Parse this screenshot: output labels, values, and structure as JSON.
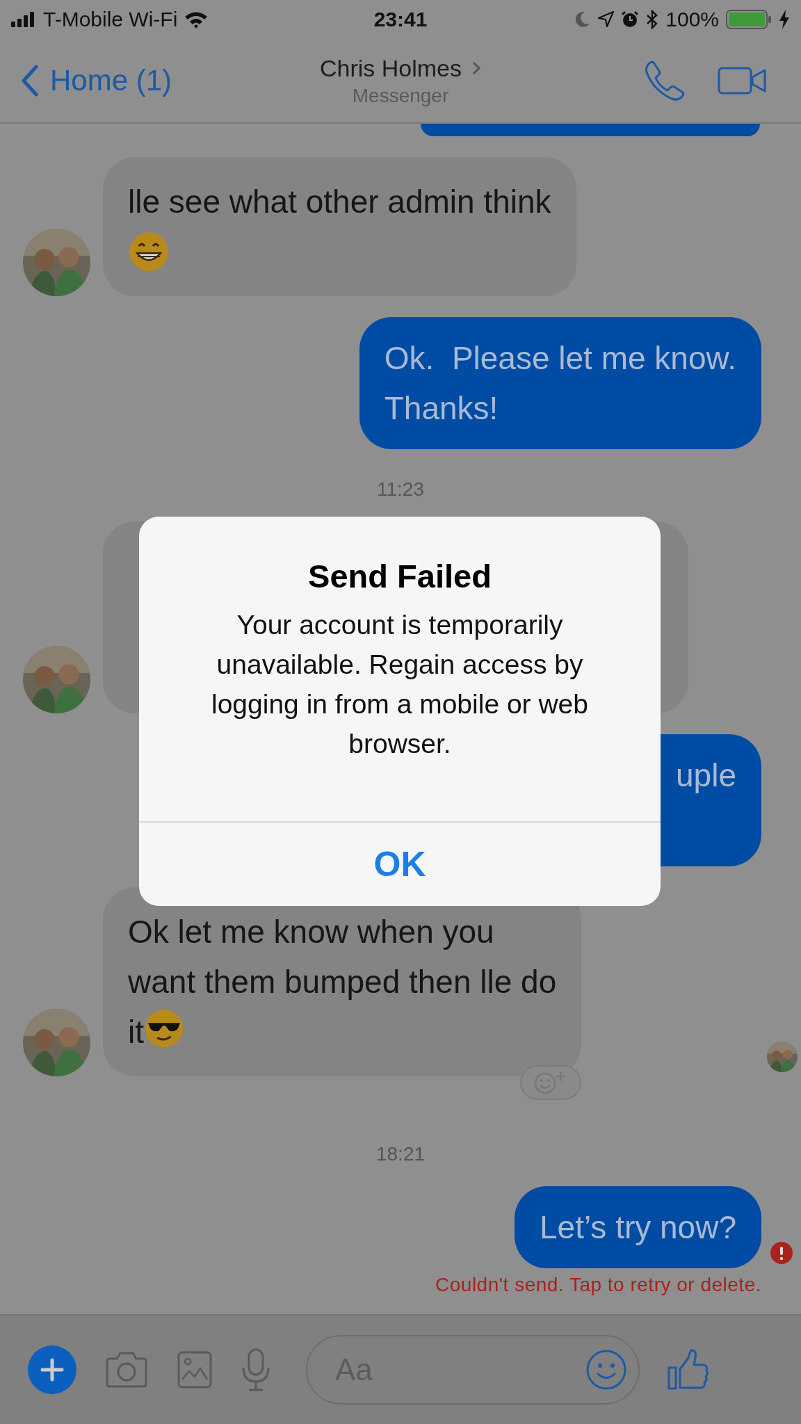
{
  "status_bar": {
    "carrier": "T-Mobile Wi-Fi",
    "time": "23:41",
    "battery": "100%"
  },
  "header": {
    "back": "Home (1)",
    "title": "Chris Holmes",
    "subtitle": "Messenger"
  },
  "messages": [
    {
      "kind": "fragment"
    },
    {
      "kind": "incoming",
      "lines": [
        "lle see what other admin think"
      ],
      "emoji_line": {
        "kind": "grin"
      },
      "avatar": true
    },
    {
      "kind": "outgoing",
      "lines": [
        "Ok.  Please let me know.",
        "Thanks!"
      ]
    },
    {
      "kind": "timestamp",
      "text": "11:23"
    },
    {
      "kind": "incoming",
      "covered": true,
      "avatar": true
    },
    {
      "kind": "outgoing",
      "lines": [
        "uple"
      ],
      "covered": true
    },
    {
      "kind": "incoming",
      "lines": [
        "Ok let me know when you",
        "want them bumped then lle do",
        "it"
      ],
      "emoji": {
        "kind": "sunglasses"
      },
      "avatar": true,
      "reaction_button": true,
      "read_avatar": true
    },
    {
      "kind": "timestamp",
      "text": "18:21"
    },
    {
      "kind": "outgoing",
      "lines": [
        "Let’s try now?"
      ],
      "failed": true,
      "error": "Couldn't send. Tap to retry or delete."
    }
  ],
  "composer": {
    "placeholder": "Aa"
  },
  "dialog": {
    "title": "Send Failed",
    "message": "Your account is temporarily unavailable. Regain access by logging in from a mobile or web browser.",
    "button": "OK"
  }
}
